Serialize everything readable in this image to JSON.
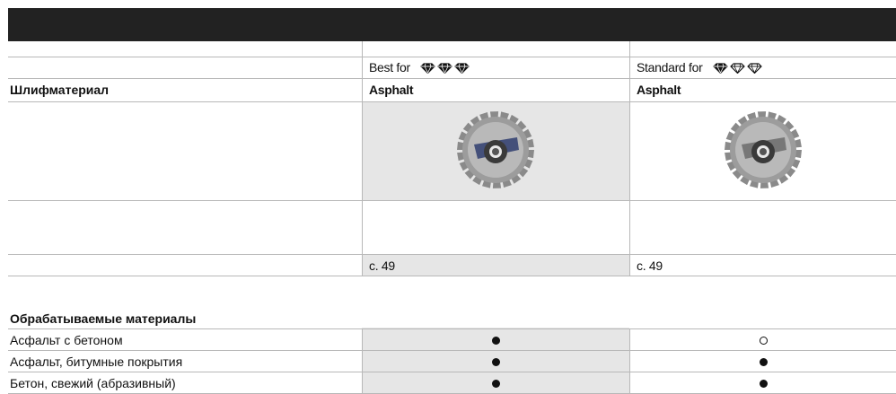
{
  "header": {
    "col1_label_prefix": "Best for",
    "col2_label_prefix": "Standard for",
    "col1_diamonds": [
      "filled",
      "filled",
      "filled"
    ],
    "col2_diamonds": [
      "filled",
      "outline",
      "outline"
    ]
  },
  "abrasive_row": {
    "label": "Шлифматериал",
    "col1": "Asphalt",
    "col2": "Asphalt"
  },
  "page_row": {
    "col1": "с. 49",
    "col2": "с. 49"
  },
  "materials": {
    "title": "Обрабатываемые материалы",
    "rows": [
      {
        "label": "Асфальт с бетоном",
        "col1": "full",
        "col2": "empty"
      },
      {
        "label": "Асфальт, битумные покрытия",
        "col1": "full",
        "col2": "full"
      },
      {
        "label": "Бетон, свежий (абразивный)",
        "col1": "full",
        "col2": "full"
      }
    ]
  },
  "colors": {
    "header_bar": "#222222",
    "column_highlight": "#e6e6e6",
    "rule": "#b8b8b8"
  }
}
